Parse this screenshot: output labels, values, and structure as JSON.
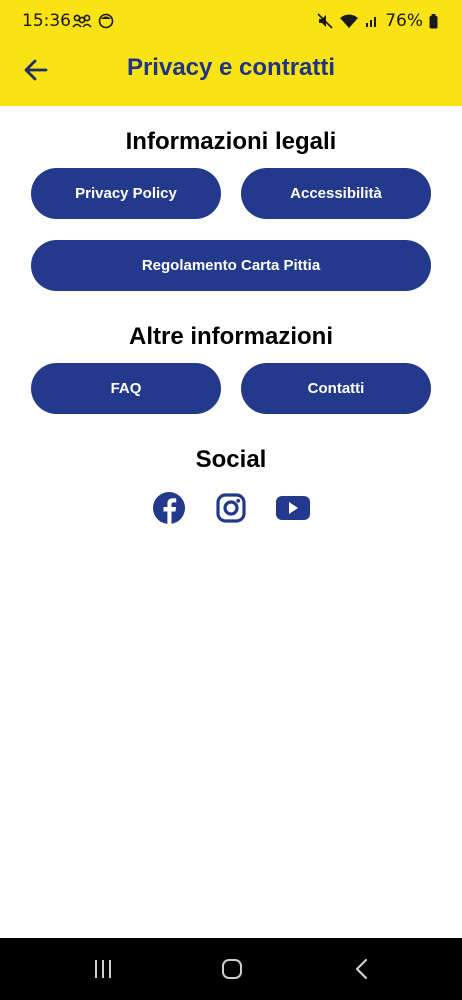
{
  "status_bar": {
    "time": "15:36",
    "battery": "76%"
  },
  "app_bar": {
    "title": "Privacy e contratti",
    "back_icon": "arrow-left-icon"
  },
  "sections": {
    "legal": {
      "title": "Informazioni legali",
      "privacy_policy": "Privacy Policy",
      "accessibility": "Accessibilità",
      "card_rules": "Regolamento Carta Pittia"
    },
    "other": {
      "title": "Altre informazioni",
      "faq": "FAQ",
      "contacts": "Contatti"
    },
    "social": {
      "title": "Social",
      "icons": [
        "facebook-icon",
        "instagram-icon",
        "youtube-icon"
      ]
    }
  },
  "colors": {
    "header_yellow": "#f9e315",
    "brand_blue": "#233a8c",
    "title_blue": "#1f3583"
  }
}
